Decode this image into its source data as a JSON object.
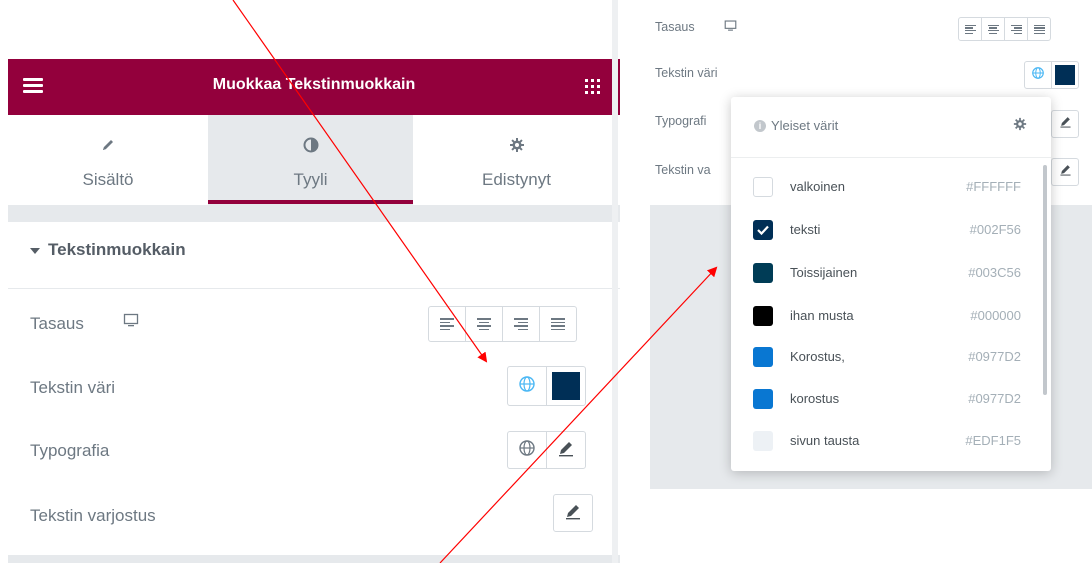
{
  "left": {
    "header_title": "Muokkaa Tekstinmuokkain",
    "tabs": [
      {
        "label": "Sisältö",
        "icon": "pencil-icon"
      },
      {
        "label": "Tyyli",
        "icon": "half-circle-icon"
      },
      {
        "label": "Edistynyt",
        "icon": "gear-icon"
      }
    ],
    "section_title": "Tekstinmuokkain",
    "controls": {
      "alignment_label": "Tasaus",
      "text_color_label": "Tekstin väri",
      "typography_label": "Typografia",
      "text_shadow_label": "Tekstin varjostus"
    }
  },
  "right": {
    "alignment_label": "Tasaus",
    "text_color_label": "Tekstin väri",
    "typography_label": "Typografi",
    "text_shadow_label": "Tekstin va",
    "popover": {
      "title": "Yleiset värit",
      "colors": [
        {
          "name": "valkoinen",
          "hex": "#FFFFFF",
          "checked": false
        },
        {
          "name": "teksti",
          "hex": "#002F56",
          "checked": true
        },
        {
          "name": "Toissijainen",
          "hex": "#003C56",
          "checked": false
        },
        {
          "name": "ihan musta",
          "hex": "#000000",
          "checked": false
        },
        {
          "name": "Korostus,",
          "hex": "#0977D2",
          "checked": false
        },
        {
          "name": "korostus",
          "hex": "#0977D2",
          "checked": false
        },
        {
          "name": "sivun tausta",
          "hex": "#EDF1F5",
          "checked": false
        }
      ]
    }
  },
  "colors": {
    "brand": "#93003c",
    "selected_text_color": "#002F56",
    "globe_accent": "#4ab7f4",
    "arrow": "#ff0000"
  }
}
